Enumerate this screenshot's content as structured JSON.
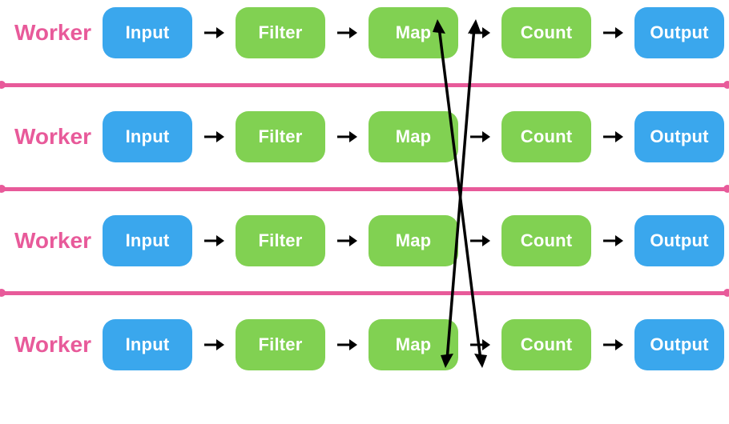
{
  "labels": {
    "worker": "Worker"
  },
  "stages": {
    "input": {
      "label": "Input",
      "color": "blue"
    },
    "filter": {
      "label": "Filter",
      "color": "green"
    },
    "map": {
      "label": "Map",
      "color": "green"
    },
    "count": {
      "label": "Count",
      "color": "green"
    },
    "output": {
      "label": "Output",
      "color": "blue"
    }
  },
  "pipeline_order": [
    "input",
    "filter",
    "map",
    "count",
    "output"
  ],
  "lane_count": 4,
  "colors": {
    "blue": "#3aa7ed",
    "green": "#81d152",
    "pink": "#e85a9a"
  }
}
